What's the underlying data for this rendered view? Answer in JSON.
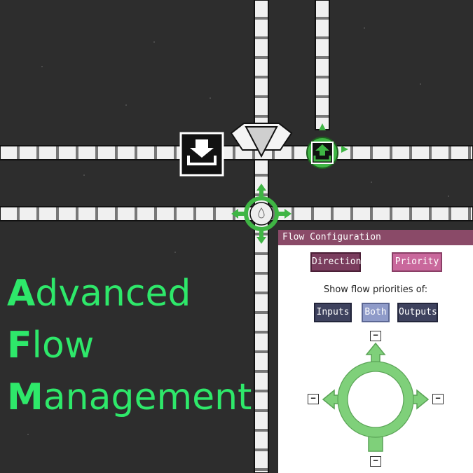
{
  "title": {
    "lines": [
      {
        "initial": "A",
        "rest": "dvanced"
      },
      {
        "initial": "F",
        "rest": "low"
      },
      {
        "initial": "M",
        "rest": "anagement"
      }
    ]
  },
  "panel": {
    "header": "Flow Configuration",
    "direction_label": "Direction",
    "priority_label": "Priority",
    "show_label": "Show flow priorities of:",
    "inputs_label": "Inputs",
    "both_label": "Both",
    "outputs_label": "Outputs",
    "minus_symbol": "−"
  },
  "colors": {
    "background": "#2d2d2d",
    "pipe": "#f2f2f2",
    "accent_green": "#2ee86a",
    "node_green": "#3fb544",
    "arrow_green": "#7fd07a"
  }
}
